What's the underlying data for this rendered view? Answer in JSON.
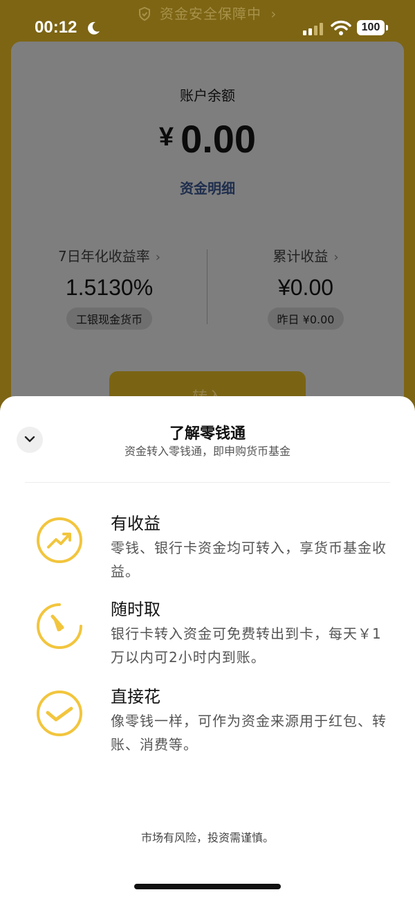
{
  "banner": {
    "text": "资金安全保障中",
    "chevron": "›"
  },
  "status_bar": {
    "time": "00:12",
    "battery": "100"
  },
  "account": {
    "balance_label": "账户余额",
    "currency": "¥",
    "balance_value": "0.00",
    "detail_link": "资金明细"
  },
  "stats": {
    "left": {
      "title": "7日年化收益率",
      "chevron": "›",
      "value": "1.5130%",
      "tag": "工银现金货币"
    },
    "right": {
      "title": "累计收益",
      "chevron": "›",
      "value": "¥0.00",
      "tag": "昨日 ¥0.00"
    }
  },
  "cta": {
    "label": "转入"
  },
  "sheet": {
    "title": "了解零钱通",
    "subtitle": "资金转入零钱通，即申购货币基金",
    "features": [
      {
        "icon": "trend-up-icon",
        "title": "有收益",
        "desc": "零钱、银行卡资金均可转入，享货币基金收益。"
      },
      {
        "icon": "gauge-icon",
        "title": "随时取",
        "desc": "银行卡转入资金可免费转出到卡，每天￥1万以内可2小时内到账。"
      },
      {
        "icon": "checkmark-icon",
        "title": "直接花",
        "desc": "像零钱一样，可作为资金来源用于红包、转账、消费等。"
      }
    ],
    "disclaimer": "市场有风险，投资需谨慎。"
  },
  "colors": {
    "accent_yellow": "#f2c53d",
    "overlay": "#7d6514",
    "sheet_bg": "#ffffff"
  }
}
